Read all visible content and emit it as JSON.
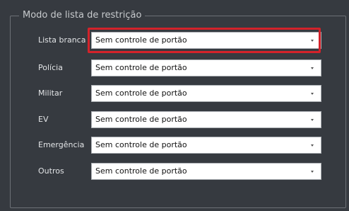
{
  "groupbox": {
    "title": "Modo de lista de restrição"
  },
  "rows": [
    {
      "label": "Lista branca",
      "value": "Sem controle de portão"
    },
    {
      "label": "Polícia",
      "value": "Sem controle de portão"
    },
    {
      "label": "Militar",
      "value": "Sem controle de portão"
    },
    {
      "label": "EV",
      "value": "Sem controle de portão"
    },
    {
      "label": "Emergência",
      "value": "Sem controle de portão"
    },
    {
      "label": "Outros",
      "value": "Sem controle de portão"
    }
  ],
  "icons": {
    "dropdown": "chevron-down-icon"
  },
  "colors": {
    "background": "#363a40",
    "highlight": "#d3222a",
    "field": "#ffffff"
  }
}
